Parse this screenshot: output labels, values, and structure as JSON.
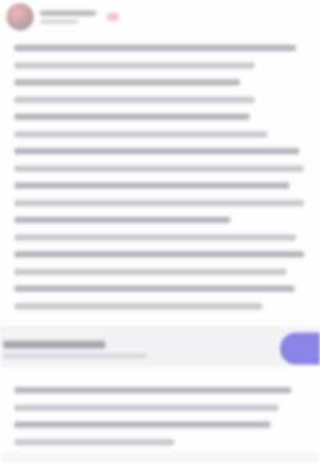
{
  "theme": {
    "accent": "#8a84e6",
    "avatar_tint": "#c9a4a8",
    "text_placeholder": "#b5b5bd"
  },
  "header": {
    "avatar_icon": "avatar-icon"
  },
  "cta": {
    "button_color": "#8a84e6"
  }
}
